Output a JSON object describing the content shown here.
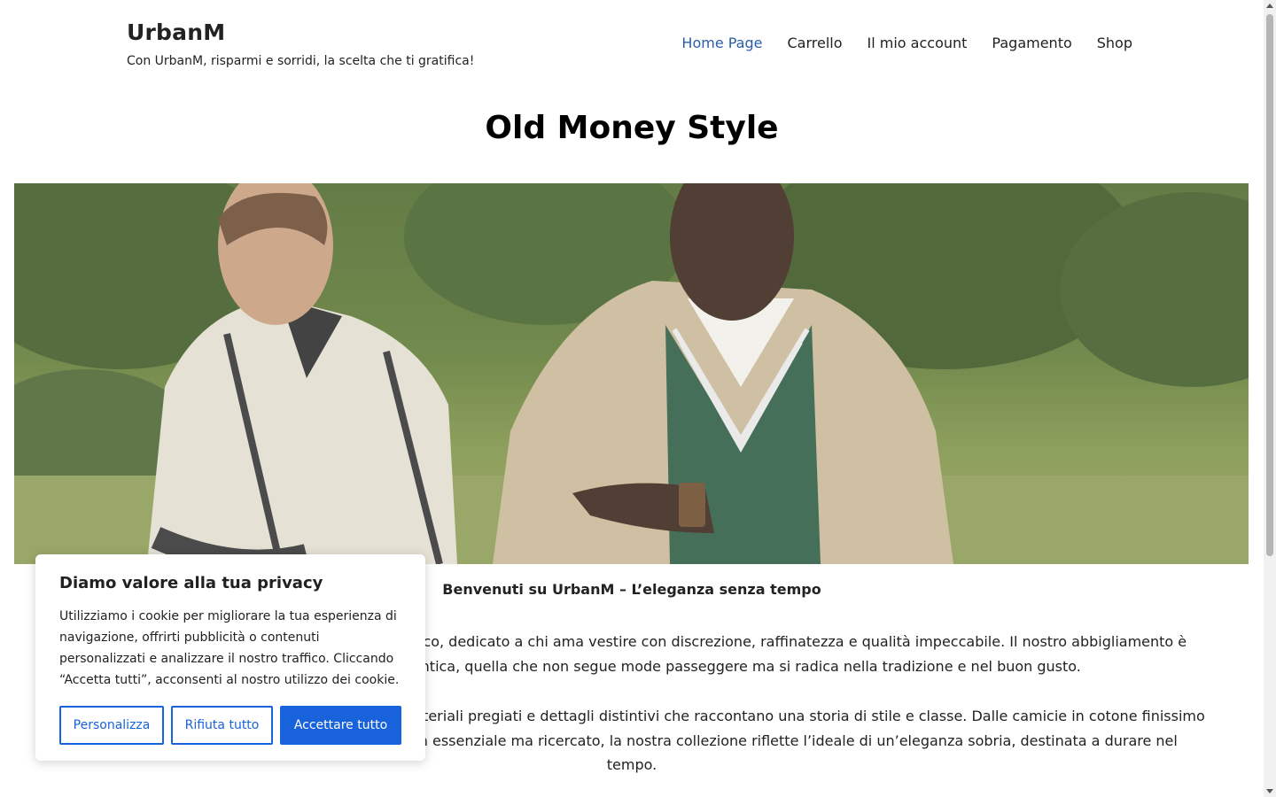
{
  "site": {
    "title": "UrbanM",
    "tagline": "Con UrbanM, risparmi e sorridi, la scelta che ti gratifica!"
  },
  "nav": {
    "items": [
      {
        "label": "Home Page",
        "active": true
      },
      {
        "label": "Carrello",
        "active": false
      },
      {
        "label": "Il mio account",
        "active": false
      },
      {
        "label": "Pagamento",
        "active": false
      },
      {
        "label": "Shop",
        "active": false
      }
    ],
    "active_color": "#2a5ea8"
  },
  "page": {
    "title": "Old Money Style",
    "hero_alt": "Due uomini in stile old money all'aperto"
  },
  "content": {
    "welcome": "Benvenuti su UrbanM – L’eleganza senza tempo",
    "paragraphs": [
      [
        "Un negozio online di abbigliamento in stile classico, dedicato a chi ama vestire con discrezione, raffinatezza e qualità impeccabile. Il nostro abbigliamento è",
        "l’espressione di un’eleganza autentica, quella che non segue mode passeggere ma si radica nella tradizione e nel buon gusto."
      ],
      [
        "Ogni capo è selezionato con cura, privilegiando materiali pregiati e dettagli distintivi che raccontano una storia di stile e classe. Dalle camicie in cotone finissimo",
        "ai blazer sartoriali, fino agli accessori dal design essenziale ma ricercato, la nostra collezione riflette l’ideale di un’eleganza sobria, destinata a durare nel",
        "tempo."
      ]
    ]
  },
  "cookie_banner": {
    "title": "Diamo valore alla tua privacy",
    "text": "Utilizziamo i cookie per migliorare la tua esperienza di navigazione, offrirti pubblicità o contenuti personalizzati e analizzare il nostro traffico. Cliccando “Accetta tutti”, acconsenti al nostro utilizzo dei cookie.",
    "buttons": {
      "customize": "Personalizza",
      "reject": "Rifiuta tutto",
      "accept": "Accettare tutto"
    },
    "accent_color": "#1863dc"
  }
}
